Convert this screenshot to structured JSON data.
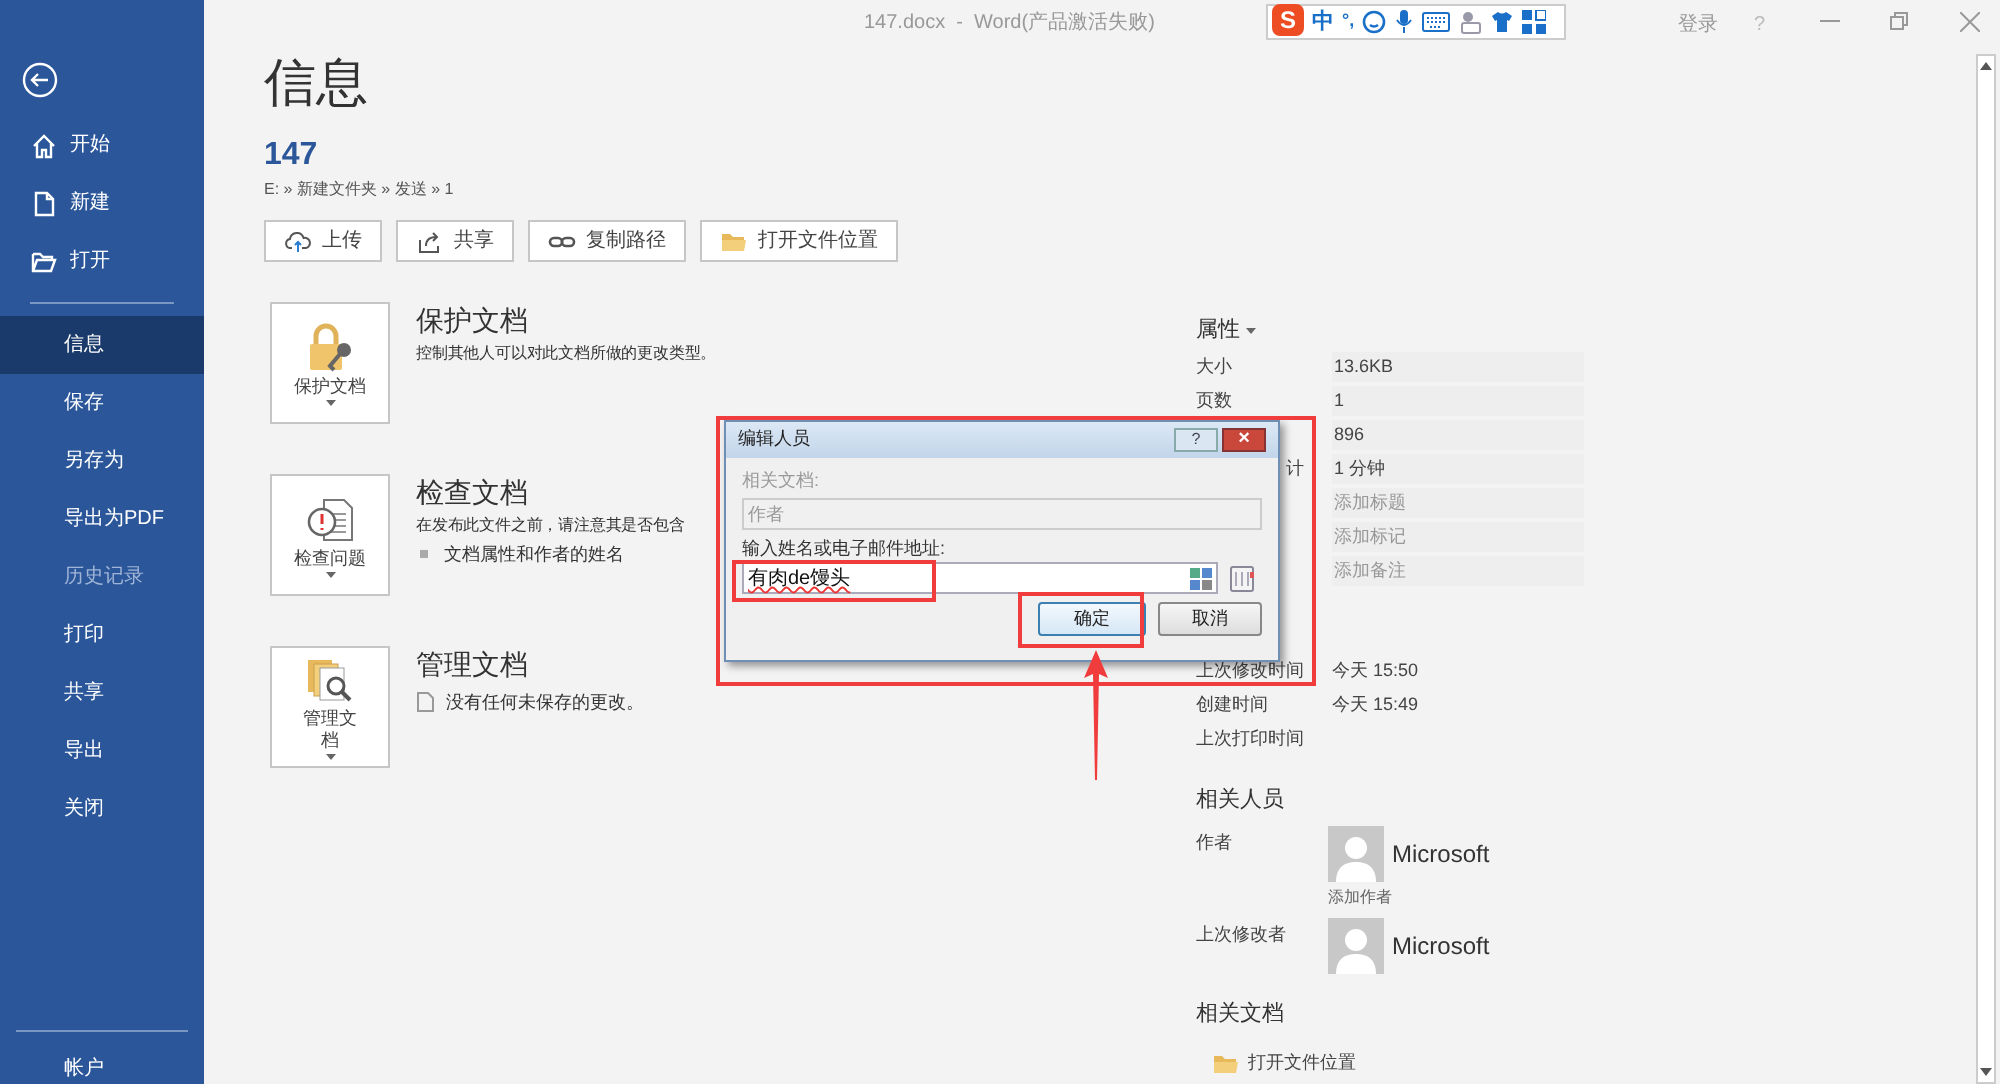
{
  "title_bar": {
    "title": "147.docx  -  Word(产品激活失败)",
    "ime": {
      "logo": "S",
      "mode": "中",
      "punct": "°,"
    },
    "signin": "登录",
    "help": "?"
  },
  "sidebar": {
    "items": [
      {
        "label": "开始",
        "kind": "home",
        "selected": false,
        "disabled": false
      },
      {
        "label": "新建",
        "kind": "new",
        "selected": false,
        "disabled": false
      },
      {
        "label": "打开",
        "kind": "open",
        "selected": false,
        "disabled": false
      },
      {
        "kind": "divider"
      },
      {
        "label": "信息",
        "kind": "text",
        "selected": true,
        "disabled": false
      },
      {
        "label": "保存",
        "kind": "text",
        "selected": false,
        "disabled": false
      },
      {
        "label": "另存为",
        "kind": "text",
        "selected": false,
        "disabled": false
      },
      {
        "label": "导出为PDF",
        "kind": "text",
        "selected": false,
        "disabled": false
      },
      {
        "label": "历史记录",
        "kind": "text",
        "selected": false,
        "disabled": true
      },
      {
        "label": "打印",
        "kind": "text",
        "selected": false,
        "disabled": false
      },
      {
        "label": "共享",
        "kind": "text",
        "selected": false,
        "disabled": false
      },
      {
        "label": "导出",
        "kind": "text",
        "selected": false,
        "disabled": false
      },
      {
        "label": "关闭",
        "kind": "text",
        "selected": false,
        "disabled": false
      }
    ],
    "account": "帐户"
  },
  "page": {
    "heading": "信息",
    "file_name": "147",
    "path": "E: » 新建文件夹 » 发送 » 1",
    "actions": [
      {
        "label": "上传",
        "kind": "upload"
      },
      {
        "label": "共享",
        "kind": "share"
      },
      {
        "label": "复制路径",
        "kind": "link"
      },
      {
        "label": "打开文件位置",
        "kind": "folder"
      }
    ],
    "sections": [
      {
        "kind": "protect",
        "button": "保护文档",
        "title": "保护文档",
        "description": "控制其他人可以对此文档所做的更改类型。"
      },
      {
        "kind": "inspect",
        "button": "检查问题",
        "title": "检查文档",
        "description": "在发布此文件之前，请注意其是否包含",
        "bullets": [
          "文档属性和作者的姓名"
        ]
      },
      {
        "kind": "manage",
        "button": "管理文档",
        "title": "管理文档",
        "note": "没有任何未保存的更改。"
      }
    ]
  },
  "properties": {
    "heading": "属性",
    "rows": [
      {
        "label": "大小",
        "value": "13.6KB"
      },
      {
        "label": "页数",
        "value": "1"
      },
      {
        "value": "896"
      },
      {
        "label": "计",
        "label_cut": true,
        "value": "1 分钟"
      },
      {
        "placeholder": "添加标题"
      },
      {
        "placeholder": "添加标记"
      },
      {
        "placeholder": "添加备注"
      }
    ],
    "dates": [
      {
        "label": "上次修改时间",
        "value": "今天 15:50"
      },
      {
        "label": "创建时间",
        "value": "今天 15:49"
      },
      {
        "label": "上次打印时间"
      }
    ],
    "people_heading": "相关人员",
    "people": [
      {
        "label": "作者",
        "name": "Microsoft",
        "add": "添加作者"
      },
      {
        "label": "上次修改者",
        "name": "Microsoft"
      }
    ],
    "docs_heading": "相关文档",
    "docs": [
      "打开文件位置"
    ]
  },
  "dialog": {
    "title": "编辑人员",
    "help": "?",
    "close": "×",
    "related_label": "相关文档:",
    "related_value": "作者",
    "input_label": "输入姓名或电子邮件地址:",
    "input_value": "有肉de馒头",
    "ok": "确定",
    "cancel": "取消"
  }
}
